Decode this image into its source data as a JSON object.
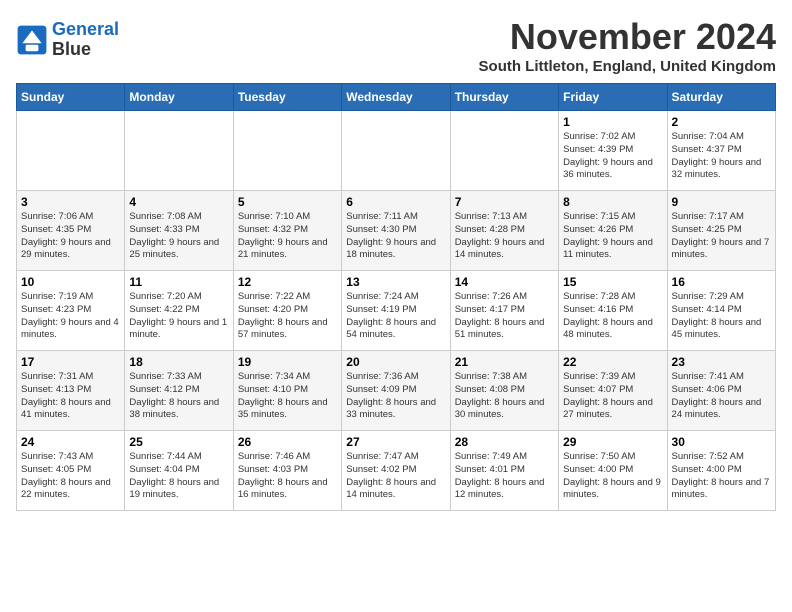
{
  "header": {
    "logo_line1": "General",
    "logo_line2": "Blue",
    "month_title": "November 2024",
    "location": "South Littleton, England, United Kingdom"
  },
  "weekdays": [
    "Sunday",
    "Monday",
    "Tuesday",
    "Wednesday",
    "Thursday",
    "Friday",
    "Saturday"
  ],
  "weeks": [
    [
      {
        "day": "",
        "info": ""
      },
      {
        "day": "",
        "info": ""
      },
      {
        "day": "",
        "info": ""
      },
      {
        "day": "",
        "info": ""
      },
      {
        "day": "",
        "info": ""
      },
      {
        "day": "1",
        "info": "Sunrise: 7:02 AM\nSunset: 4:39 PM\nDaylight: 9 hours\nand 36 minutes."
      },
      {
        "day": "2",
        "info": "Sunrise: 7:04 AM\nSunset: 4:37 PM\nDaylight: 9 hours\nand 32 minutes."
      }
    ],
    [
      {
        "day": "3",
        "info": "Sunrise: 7:06 AM\nSunset: 4:35 PM\nDaylight: 9 hours\nand 29 minutes."
      },
      {
        "day": "4",
        "info": "Sunrise: 7:08 AM\nSunset: 4:33 PM\nDaylight: 9 hours\nand 25 minutes."
      },
      {
        "day": "5",
        "info": "Sunrise: 7:10 AM\nSunset: 4:32 PM\nDaylight: 9 hours\nand 21 minutes."
      },
      {
        "day": "6",
        "info": "Sunrise: 7:11 AM\nSunset: 4:30 PM\nDaylight: 9 hours\nand 18 minutes."
      },
      {
        "day": "7",
        "info": "Sunrise: 7:13 AM\nSunset: 4:28 PM\nDaylight: 9 hours\nand 14 minutes."
      },
      {
        "day": "8",
        "info": "Sunrise: 7:15 AM\nSunset: 4:26 PM\nDaylight: 9 hours\nand 11 minutes."
      },
      {
        "day": "9",
        "info": "Sunrise: 7:17 AM\nSunset: 4:25 PM\nDaylight: 9 hours\nand 7 minutes."
      }
    ],
    [
      {
        "day": "10",
        "info": "Sunrise: 7:19 AM\nSunset: 4:23 PM\nDaylight: 9 hours\nand 4 minutes."
      },
      {
        "day": "11",
        "info": "Sunrise: 7:20 AM\nSunset: 4:22 PM\nDaylight: 9 hours\nand 1 minute."
      },
      {
        "day": "12",
        "info": "Sunrise: 7:22 AM\nSunset: 4:20 PM\nDaylight: 8 hours\nand 57 minutes."
      },
      {
        "day": "13",
        "info": "Sunrise: 7:24 AM\nSunset: 4:19 PM\nDaylight: 8 hours\nand 54 minutes."
      },
      {
        "day": "14",
        "info": "Sunrise: 7:26 AM\nSunset: 4:17 PM\nDaylight: 8 hours\nand 51 minutes."
      },
      {
        "day": "15",
        "info": "Sunrise: 7:28 AM\nSunset: 4:16 PM\nDaylight: 8 hours\nand 48 minutes."
      },
      {
        "day": "16",
        "info": "Sunrise: 7:29 AM\nSunset: 4:14 PM\nDaylight: 8 hours\nand 45 minutes."
      }
    ],
    [
      {
        "day": "17",
        "info": "Sunrise: 7:31 AM\nSunset: 4:13 PM\nDaylight: 8 hours\nand 41 minutes."
      },
      {
        "day": "18",
        "info": "Sunrise: 7:33 AM\nSunset: 4:12 PM\nDaylight: 8 hours\nand 38 minutes."
      },
      {
        "day": "19",
        "info": "Sunrise: 7:34 AM\nSunset: 4:10 PM\nDaylight: 8 hours\nand 35 minutes."
      },
      {
        "day": "20",
        "info": "Sunrise: 7:36 AM\nSunset: 4:09 PM\nDaylight: 8 hours\nand 33 minutes."
      },
      {
        "day": "21",
        "info": "Sunrise: 7:38 AM\nSunset: 4:08 PM\nDaylight: 8 hours\nand 30 minutes."
      },
      {
        "day": "22",
        "info": "Sunrise: 7:39 AM\nSunset: 4:07 PM\nDaylight: 8 hours\nand 27 minutes."
      },
      {
        "day": "23",
        "info": "Sunrise: 7:41 AM\nSunset: 4:06 PM\nDaylight: 8 hours\nand 24 minutes."
      }
    ],
    [
      {
        "day": "24",
        "info": "Sunrise: 7:43 AM\nSunset: 4:05 PM\nDaylight: 8 hours\nand 22 minutes."
      },
      {
        "day": "25",
        "info": "Sunrise: 7:44 AM\nSunset: 4:04 PM\nDaylight: 8 hours\nand 19 minutes."
      },
      {
        "day": "26",
        "info": "Sunrise: 7:46 AM\nSunset: 4:03 PM\nDaylight: 8 hours\nand 16 minutes."
      },
      {
        "day": "27",
        "info": "Sunrise: 7:47 AM\nSunset: 4:02 PM\nDaylight: 8 hours\nand 14 minutes."
      },
      {
        "day": "28",
        "info": "Sunrise: 7:49 AM\nSunset: 4:01 PM\nDaylight: 8 hours\nand 12 minutes."
      },
      {
        "day": "29",
        "info": "Sunrise: 7:50 AM\nSunset: 4:00 PM\nDaylight: 8 hours\nand 9 minutes."
      },
      {
        "day": "30",
        "info": "Sunrise: 7:52 AM\nSunset: 4:00 PM\nDaylight: 8 hours\nand 7 minutes."
      }
    ]
  ]
}
